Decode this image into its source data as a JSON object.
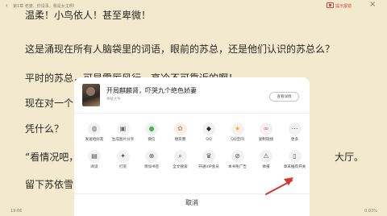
{
  "topbar": {
    "back_glyph": "‹",
    "chapter": "第1章 老婆、你没事，我是女主啊!",
    "report": "提示报错",
    "close_glyph": "×"
  },
  "content": {
    "p1": "温柔！小鸟依人！甚至卑微！",
    "p2": "这是涌现在所有人脑袋里的词语，眼前的苏总，还是他们认识的苏总么？",
    "p3": "平时的苏总，可是雷厉风行，高冷不可靠近的啊！",
    "p4": "现在对一个",
    "p5": "凭什么？",
    "p6": "“看情况吧，",
    "p6_right": "大厅。",
    "p7": "留下苏依雪"
  },
  "bottombar": {
    "time": "19:06",
    "progress": "0.03%"
  },
  "share_sheet": {
    "book": {
      "title": "开局麒麟肾，吓哭九个绝色娇妻",
      "author": "神级大牛",
      "detail_button": "查看详情"
    },
    "row1": [
      {
        "name": "chat-icon",
        "glyph": "◍",
        "color": "#6c6c6c",
        "label": "发送给好友"
      },
      {
        "name": "image-icon",
        "glyph": "▣",
        "color": "#6c6c6c",
        "label": "生成图片分享"
      },
      {
        "name": "wechat-icon",
        "glyph": "●",
        "color": "#3dbb4b",
        "label": "微信"
      },
      {
        "name": "moments-icon",
        "glyph": "✿",
        "color": "#e98a2e",
        "label": "朋友圈"
      },
      {
        "name": "qq-icon",
        "glyph": "◆",
        "color": "#2a2a2a",
        "label": "QQ"
      },
      {
        "name": "qzone-icon",
        "glyph": "★",
        "color": "#f3b411",
        "label": "QQ空间"
      },
      {
        "name": "link-icon",
        "glyph": "∞",
        "color": "#e0584b",
        "label": "复制链接"
      },
      {
        "name": "more-icon",
        "glyph": "⋯",
        "color": "#555555",
        "label": "更多"
      }
    ],
    "row2": [
      {
        "name": "reading-icon",
        "glyph": "▤",
        "color": "#555555",
        "label": "阅读"
      },
      {
        "name": "gift-icon",
        "glyph": "✦",
        "color": "#555555",
        "label": "打赏"
      },
      {
        "name": "bookmark-add-icon",
        "glyph": "⊕",
        "color": "#555555",
        "label": "添加书签"
      },
      {
        "name": "search-icon",
        "glyph": "⌕",
        "color": "#555555",
        "label": "全文搜索"
      },
      {
        "name": "vip-icon",
        "glyph": "♛",
        "color": "#555555",
        "label": "开通VIP会员"
      },
      {
        "name": "no-ads-icon",
        "glyph": "⊘",
        "color": "#555555",
        "label": "本书免广告"
      },
      {
        "name": "report-icon",
        "glyph": "⚠",
        "color": "#555555",
        "label": "举报"
      },
      {
        "name": "chapter-end-icon",
        "glyph": "▯",
        "color": "#555555",
        "label": "章末推荐开关"
      }
    ],
    "cancel": "取消"
  },
  "colors": {
    "page_bg": "#f3e9cf",
    "sheet_bg": "#ffffff",
    "arrow": "#d9352b",
    "report_red": "#d14a3c"
  }
}
